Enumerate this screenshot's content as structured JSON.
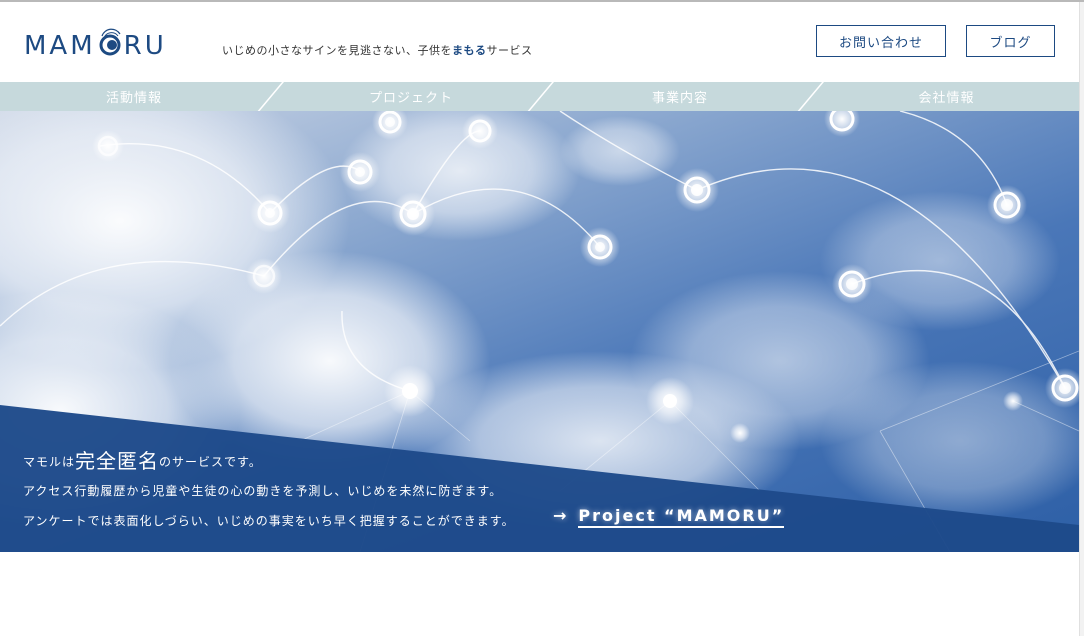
{
  "header": {
    "logo_text_a": "MAM",
    "logo_text_b": "RU",
    "tagline_pre": "いじめの小さなサインを見逃さない、子供を",
    "tagline_em": "まもる",
    "tagline_post": "サービス",
    "contact_label": "お問い合わせ",
    "blog_label": "ブログ"
  },
  "nav": {
    "items": [
      {
        "label": "活動情報"
      },
      {
        "label": "プロジェクト"
      },
      {
        "label": "事業内容"
      },
      {
        "label": "会社情報"
      }
    ]
  },
  "hero": {
    "line1_pre": "マモルは",
    "line1_big": "完全匿名",
    "line1_post": "のサービスです。",
    "line2": "アクセス行動履歴から児童や生徒の心の動きを予測し、いじめを未然に防ぎます。",
    "line3": "アンケートでは表面化しづらい、いじめの事実をいち早く把握することができます。",
    "link_arrow": "→",
    "link_label": "Project “MAMORU”"
  },
  "colors": {
    "brand": "#1d4a82",
    "nav_bg": "#c6d9dc",
    "band": "#1e4a8a"
  }
}
